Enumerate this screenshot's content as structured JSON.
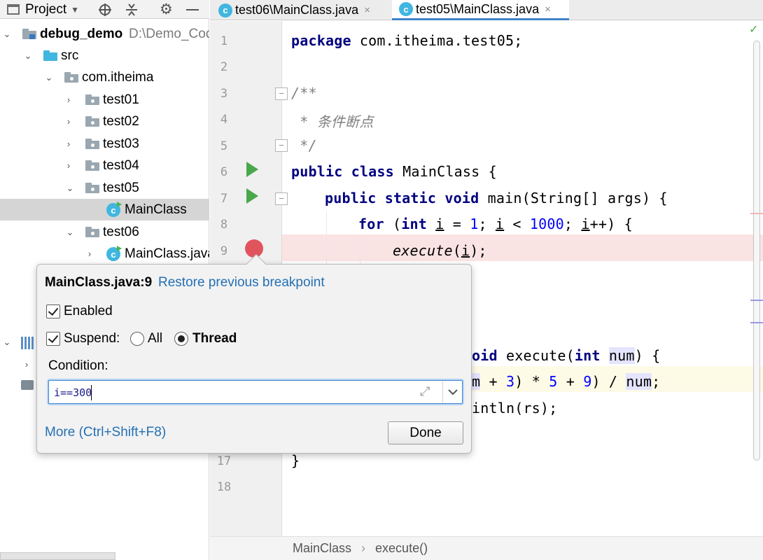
{
  "project_panel": {
    "title": "Project",
    "tree": {
      "root": {
        "name": "debug_demo",
        "path": "D:\\Demo_Code"
      },
      "src": "src",
      "package": "com.itheima",
      "folders": [
        "test01",
        "test02",
        "test03",
        "test04",
        "test05"
      ],
      "test05_child": "MainClass",
      "test06": "test06",
      "test06_child": "MainClass.java"
    }
  },
  "tabs": [
    {
      "label": "test06\\MainClass.java",
      "close": "×"
    },
    {
      "label": "test05\\MainClass.java",
      "close": "×"
    }
  ],
  "editor": {
    "line_numbers": {
      "l1": "1",
      "l2": "2",
      "l3": "3",
      "l4": "4",
      "l5": "5",
      "l6": "6",
      "l7": "7",
      "l8": "8",
      "l9": "9",
      "l17": "17",
      "l18": "18"
    },
    "code": {
      "l1_kw": "package",
      "l1_rest": " com.itheima.test05;",
      "l3": "/**",
      "l4": " * 条件断点",
      "l5": " */",
      "l6_kw1": "public",
      "l6_kw2": "class",
      "l6_rest": " MainClass {",
      "l7_kw1": "public",
      "l7_kw2": "static",
      "l7_kw3": "void",
      "l7_rest": " main(String[] args) {",
      "l8_kw1": "for",
      "l8_a": " (",
      "l8_kw2": "int",
      "l8_b": " ",
      "l8_i1": "i",
      "l8_c": " = ",
      "l8_n1": "1",
      "l8_d": "; ",
      "l8_i2": "i",
      "l8_e": " < ",
      "l8_n2": "1000",
      "l8_f": "; ",
      "l8_i3": "i",
      "l8_g": "++) {",
      "l9_call": "execute",
      "l9_a": "(",
      "l9_i": "i",
      "l9_b": ");",
      "l13_kw1": "oid",
      "l13_a": " execute(",
      "l13_kw2": "int",
      "l13_b": " ",
      "l13_p": "num",
      "l13_c": ") {",
      "l14_p": "m",
      "l14_a": " + ",
      "l14_n1": "3",
      "l14_b": ") * ",
      "l14_n2": "5",
      "l14_c": " + ",
      "l14_n3": "9",
      "l14_d": ") / ",
      "l14_p2": "num",
      "l14_e": ";",
      "l15": "intln(rs);",
      "l17": "}"
    }
  },
  "breadcrumb": {
    "class": "MainClass",
    "separator": "›",
    "method": "execute()"
  },
  "breakpoint_popup": {
    "title": "MainClass.java:9",
    "restore_link": "Restore previous breakpoint",
    "enabled_label": "Enabled",
    "enabled": true,
    "suspend_label": "Suspend:",
    "suspend": true,
    "option_all": "All",
    "option_thread": "Thread",
    "selected_option": "Thread",
    "condition_label": "Condition:",
    "condition_value": "i==300",
    "more_link": "More (Ctrl+Shift+F8)",
    "done_label": "Done"
  },
  "colors": {
    "keyword": "#000080",
    "number": "#0000ff",
    "comment": "#808080",
    "link": "#2470b3",
    "breakpoint": "#e0555d",
    "breakpoint_line": "#fae3e3",
    "run_icon": "#49a84b"
  }
}
